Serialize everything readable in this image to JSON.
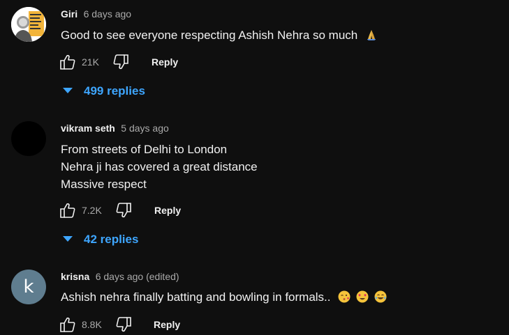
{
  "comments": [
    {
      "author": "Giri",
      "time": "6 days ago",
      "lines": [
        "Good to see everyone respecting Ashish Nehra so much"
      ],
      "emojis": [
        "folded-hands"
      ],
      "likes": "21K",
      "reply_label": "Reply",
      "replies": "499 replies",
      "avatar_type": "photo"
    },
    {
      "author": "vikram seth",
      "time": "5 days ago",
      "lines": [
        "From streets of Delhi to London",
        "Nehra ji has covered a great distance",
        "Massive respect"
      ],
      "likes": "7.2K",
      "reply_label": "Reply",
      "replies": "42 replies",
      "avatar_type": "dark"
    },
    {
      "author": "krisna",
      "time": "6 days ago (edited)",
      "lines": [
        "Ashish nehra finally batting and bowling in formals.."
      ],
      "emojis": [
        "kissing-face",
        "heart-eyes-face",
        "tears-of-joy-face"
      ],
      "likes": "8.8K",
      "reply_label": "Reply",
      "avatar_letter": "k",
      "avatar_type": "letter"
    }
  ],
  "colors": {
    "background": "#0f0f0f",
    "link_blue": "#3ea6ff",
    "secondary_text": "#aaaaaa"
  }
}
